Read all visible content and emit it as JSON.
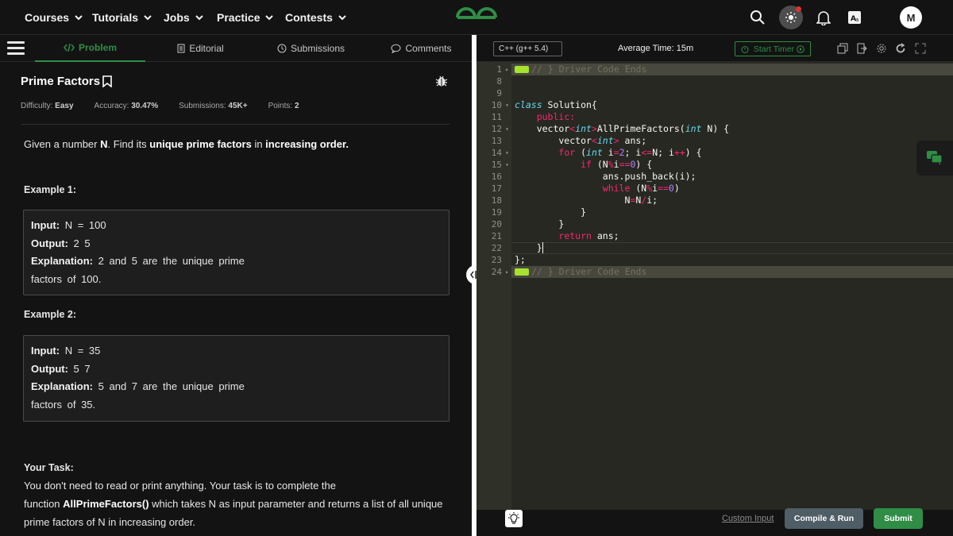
{
  "topnav": {
    "items": [
      {
        "label": "Courses"
      },
      {
        "label": "Tutorials"
      },
      {
        "label": "Jobs"
      },
      {
        "label": "Practice"
      },
      {
        "label": "Contests"
      }
    ],
    "avatar_initial": "M"
  },
  "tabs": {
    "problem": "Problem",
    "editorial": "Editorial",
    "submissions": "Submissions",
    "comments": "Comments"
  },
  "problem": {
    "title": "Prime Factors",
    "difficulty_label": "Difficulty:",
    "difficulty": "Easy",
    "accuracy_label": "Accuracy:",
    "accuracy": "30.47%",
    "submissions_label": "Submissions:",
    "submissions": "45K+",
    "points_label": "Points:",
    "points": "2",
    "statement_parts": [
      "Given a number ",
      "N",
      ". Find its ",
      "unique prime factors",
      " in ",
      "increasing order."
    ],
    "examples": [
      {
        "heading": "Example 1:",
        "input_label": "Input:",
        "input": "N = 100",
        "output_label": "Output:",
        "output": "2 5",
        "explanation_label": "Explanation:",
        "explanation_1": "2 and 5 are the unique prime",
        "explanation_2": "factors of 100."
      },
      {
        "heading": "Example 2:",
        "input_label": "Input:",
        "input": "N = 35",
        "output_label": "Output:",
        "output": "5 7",
        "explanation_label": "Explanation:",
        "explanation_1": "5 and 7 are the unique prime",
        "explanation_2": "factors of 35."
      }
    ],
    "task_heading": "Your Task:",
    "task_line1": "You don't need to read or print anything. Your task is to complete the",
    "task_prefix": "function ",
    "task_func": "AllPrimeFactors()",
    "task_line2_rest": " which takes N as input parameter and returns a list of all unique",
    "task_line3": "prime factors of N in increasing order."
  },
  "editor": {
    "language": "C++ (g++ 5.4)",
    "avg_time": "Average Time: 15m",
    "start_timer": "Start Timer",
    "line_numbers": [
      "1",
      "8",
      "9",
      "10",
      "11",
      "12",
      "13",
      "14",
      "15",
      "16",
      "17",
      "18",
      "19",
      "20",
      "21",
      "22",
      "23",
      "24"
    ],
    "driver_comment": "// } Driver Code Ends",
    "custom_input": "Custom Input",
    "compile_run": "Compile & Run",
    "submit": "Submit"
  },
  "colors": {
    "brand_green": "#2f8d46",
    "editor_bg": "#272822",
    "page_bg": "#131313"
  }
}
